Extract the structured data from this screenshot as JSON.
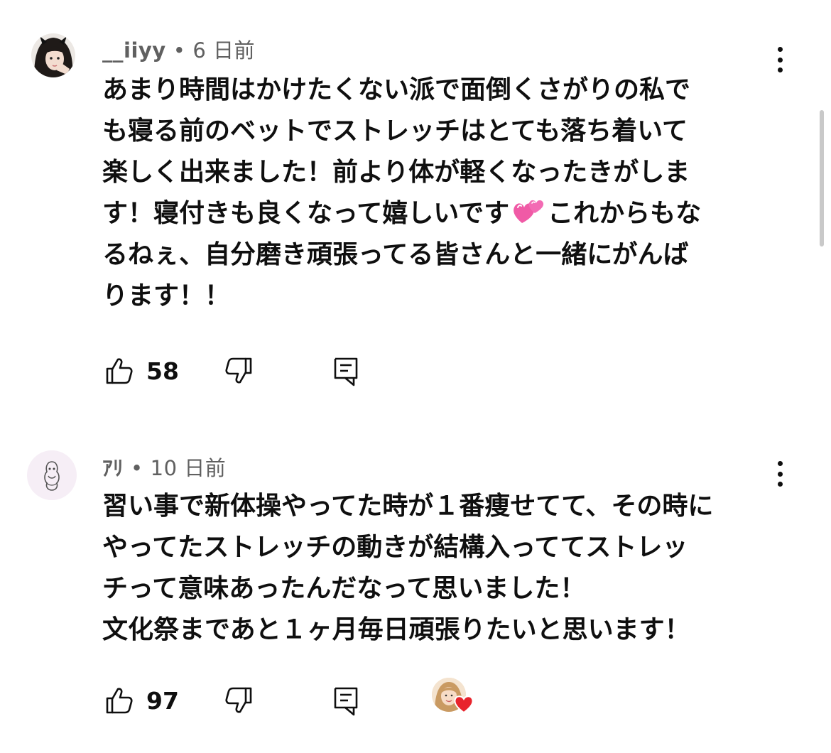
{
  "comments": [
    {
      "author": "__iiyy",
      "separator": "•",
      "time": "6 日前",
      "lines": [
        "あまり時間はかけたくない派で面倒くさがりの私で",
        "も寝る前のベットでストレッチはとても落ち着いて",
        "楽しく出来ました！前より体が軽くなったきがしま",
        "す！寝付きも良くなって嬉しいです",
        "これからもな",
        "るねぇ、自分磨き頑張ってる皆さんと一緒にがんば",
        "ります！！"
      ],
      "emoji": "two-hearts-emoji",
      "like_count": "58",
      "avatar_icon": "user-avatar-dark-hair"
    },
    {
      "author": "ｱﾘ",
      "separator": "•",
      "time": "10 日前",
      "lines": [
        "習い事で新体操やってた時が１番痩せてて、その時に",
        "やってたストレッチの動きが結構入っててストレッ",
        "チって意味あったんだなって思いました！",
        "文化祭まであと１ヶ月毎日頑張りたいと思います！"
      ],
      "like_count": "97",
      "avatar_icon": "user-avatar-sketch",
      "creator_heart": true
    }
  ],
  "colors": {
    "text_primary": "#0f0f0f",
    "text_secondary": "#606060",
    "heart_red": "#e8242c",
    "emoji_pink": "#f05aa6"
  },
  "icons": {
    "like": "thumbs-up-icon",
    "dislike": "thumbs-down-icon",
    "reply": "reply-icon",
    "more": "more-vertical-icon"
  }
}
